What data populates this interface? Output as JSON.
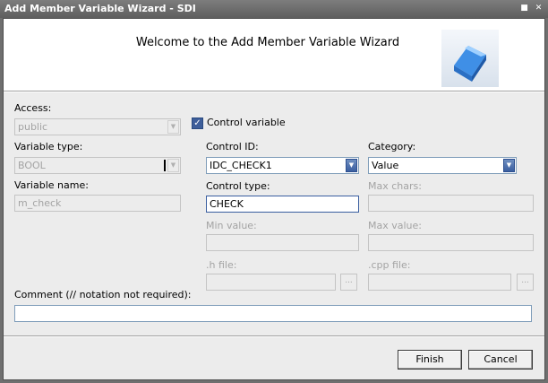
{
  "window": {
    "title": "Add Member Variable Wizard - SDI"
  },
  "header": {
    "title": "Welcome to the Add Member Variable Wizard"
  },
  "form": {
    "access_label": "Access:",
    "access_value": "public",
    "control_variable_label": "Control variable",
    "variable_type_label": "Variable type:",
    "variable_type_value": "BOOL",
    "variable_name_label": "Variable name:",
    "variable_name_value": "m_check",
    "control_id_label": "Control ID:",
    "control_id_value": "IDC_CHECK1",
    "control_type_label": "Control type:",
    "control_type_value": "CHECK",
    "category_label": "Category:",
    "category_value": "Value",
    "max_chars_label": "Max chars:",
    "min_value_label": "Min value:",
    "max_value_label": "Max value:",
    "h_file_label": ".h file:",
    "cpp_file_label": ".cpp file:",
    "browse_label": "...",
    "comment_label": "Comment (// notation not required):",
    "comment_value": ""
  },
  "buttons": {
    "finish": "Finish",
    "cancel": "Cancel"
  },
  "icons": {
    "minimize": "minimize-icon",
    "close": "close-icon",
    "wizard_logo": "cube-logo-icon",
    "dropdown": "chevron-down-icon",
    "checkmark": "checkmark-icon"
  },
  "colors": {
    "titlebar": "#6f6f6f",
    "accent": "#3e5e9a",
    "logo_blue": "#3a8de0"
  }
}
